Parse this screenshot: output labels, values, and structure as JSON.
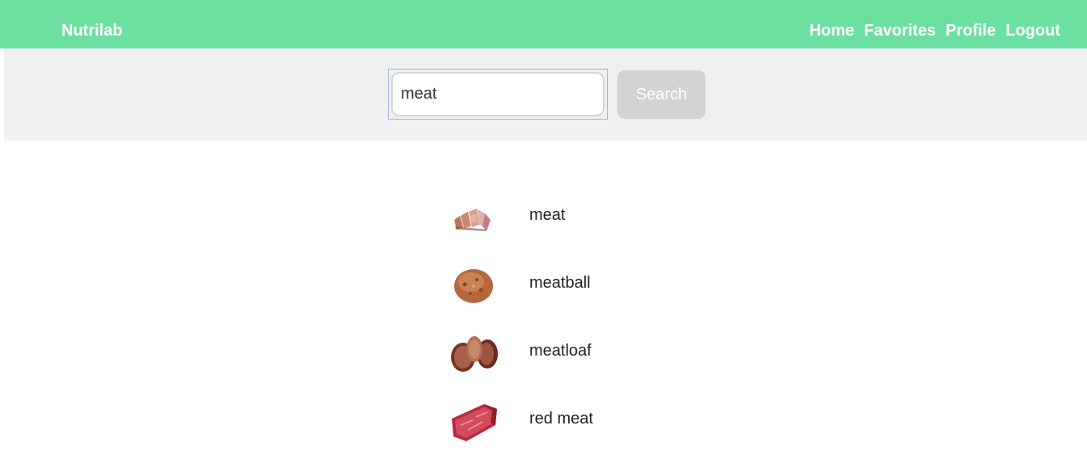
{
  "header": {
    "brand": "Nutrilab",
    "nav": [
      {
        "label": "Home"
      },
      {
        "label": "Favorites"
      },
      {
        "label": "Profile"
      },
      {
        "label": "Logout"
      }
    ]
  },
  "search": {
    "value": "meat",
    "placeholder": "",
    "button_label": "Search"
  },
  "results": [
    {
      "label": "meat",
      "icon": "sliced-meat-image"
    },
    {
      "label": "meatball",
      "icon": "meatball-image"
    },
    {
      "label": "meatloaf",
      "icon": "meatloaf-image"
    },
    {
      "label": "red meat",
      "icon": "red-meat-image"
    }
  ],
  "colors": {
    "header_bg": "#6ce0a0",
    "search_band_bg": "#f0f0f0",
    "button_disabled": "#d3d3d3"
  }
}
